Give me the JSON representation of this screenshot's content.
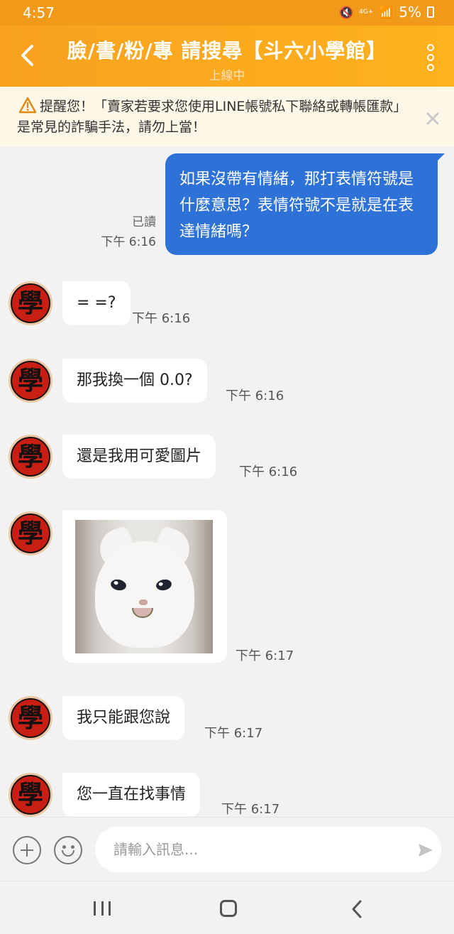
{
  "status_bar": {
    "time": "4:57",
    "network": "4G+",
    "battery": "5%"
  },
  "header": {
    "title": "臉/書/粉/專 請搜尋【斗六小學館】",
    "subtitle": "上線中"
  },
  "warning": {
    "text": "提醒您！「賣家若要求您使用LINE帳號私下聯絡或轉帳匯款」是常見的詐騙手法，請勿上當！"
  },
  "avatar_glyph": "學",
  "messages": {
    "sent": {
      "text": "如果沒帶有情緒，那打表情符號是什麼意思？表情符號不是就是在表達情緒嗎？",
      "read": "已讀",
      "time": "下午 6:16"
    },
    "received": [
      {
        "text": "= =?",
        "time": "下午 6:16"
      },
      {
        "text": "那我換一個 0.0?",
        "time": "下午 6:16"
      },
      {
        "text": "還是我用可愛圖片",
        "time": "下午 6:16"
      },
      {
        "image": "crying-cat-sticker",
        "time": "下午 6:17"
      },
      {
        "text": "我只能跟您說",
        "time": "下午 6:17"
      },
      {
        "text": "您一直在找事情",
        "time": "下午 6:17"
      }
    ]
  },
  "input": {
    "placeholder": "請輸入訊息..."
  },
  "colors": {
    "header": "#ffb21d",
    "sent_bubble": "#2e72d8",
    "avatar": "#c81e14"
  }
}
